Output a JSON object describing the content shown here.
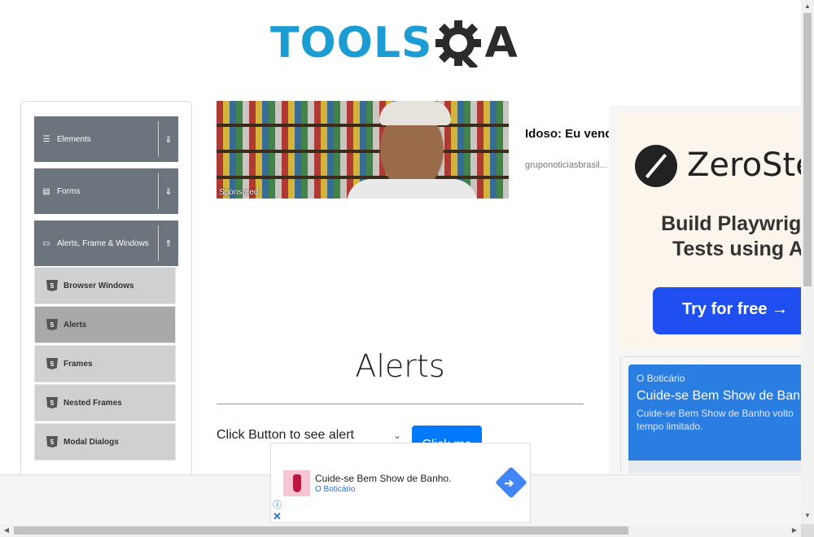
{
  "logo": {
    "text_main": "TOOLS",
    "text_end": "A"
  },
  "sidebar": {
    "groups": [
      {
        "label": "Elements",
        "icon": "hamburger-icon",
        "state": "collapsed"
      },
      {
        "label": "Forms",
        "icon": "form-icon",
        "state": "collapsed"
      },
      {
        "label": "Alerts, Frame & Windows",
        "icon": "window-icon",
        "state": "expanded"
      }
    ],
    "group_icons": {
      "elements": "☰",
      "forms": "▤",
      "alerts": "▭"
    },
    "arrows": {
      "down": "⇓",
      "up": "⇑"
    },
    "subitems": [
      {
        "label": "Browser Windows",
        "active": false
      },
      {
        "label": "Alerts",
        "active": true
      },
      {
        "label": "Frames",
        "active": false
      },
      {
        "label": "Nested Frames",
        "active": false
      },
      {
        "label": "Modal Dialogs",
        "active": false
      }
    ],
    "subitem_icon_text": "5"
  },
  "sponsored_ad": {
    "badge": "Sponsored",
    "title": "Idoso: Eu vendo natural",
    "source": "gruponoticiasbrasil..."
  },
  "main": {
    "title": "Alerts",
    "prompt": "Click Button to see alert",
    "chevron": "⌄",
    "button_label": "Click me"
  },
  "right_ad": {
    "brand": "ZeroStep",
    "headline_line1": "Build Playwright",
    "headline_line2": "Tests using AI",
    "cta": "Try for free →"
  },
  "side_ad": {
    "brand": "O Boticário",
    "title": "Cuide-se Bem Show de Banho.",
    "desc_line1": "Cuide-se Bem Show de Banho volto",
    "desc_line2": "tempo limitado."
  },
  "bottom_ad": {
    "title": "Cuide-se Bem Show de Banho.",
    "brand": "O Boticário",
    "info": "ⓘ",
    "close": "✕",
    "arrow": "➔"
  },
  "scrollbars": {
    "up": "▲",
    "down": "▼",
    "left": "◀",
    "right": "▶"
  },
  "colors": {
    "accent": "#007bff",
    "sidebar_group": "#6c757d",
    "logo_blue": "#1b9dd4"
  }
}
